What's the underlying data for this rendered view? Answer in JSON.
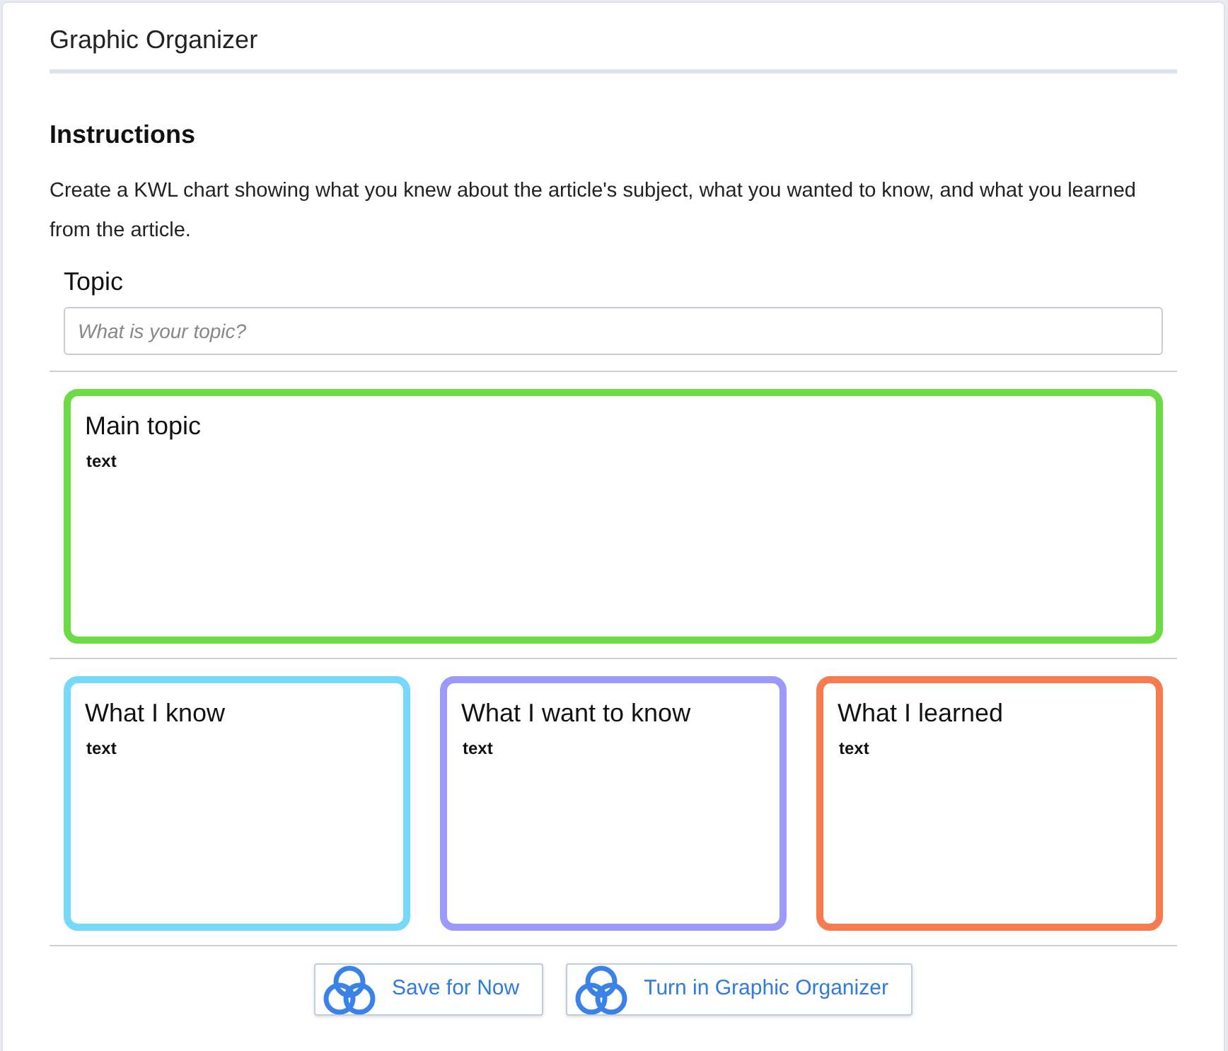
{
  "panel": {
    "title": "Graphic Organizer"
  },
  "instructions": {
    "heading": "Instructions",
    "text": "Create a KWL chart showing what you knew about the article's subject, what you wanted to know, and what you learned from the article."
  },
  "topic": {
    "label": "Topic",
    "placeholder": "What is your topic?"
  },
  "main_box": {
    "title": "Main topic",
    "text": "text",
    "color": "#6cdb45"
  },
  "boxes": [
    {
      "title": "What I know",
      "text": "text",
      "color": "#76d9fb"
    },
    {
      "title": "What I want to know",
      "text": "text",
      "color": "#9b9afb"
    },
    {
      "title": "What I learned",
      "text": "text",
      "color": "#f67b4f"
    }
  ],
  "buttons": [
    "Save for Now",
    "Turn in Graphic Organizer"
  ]
}
